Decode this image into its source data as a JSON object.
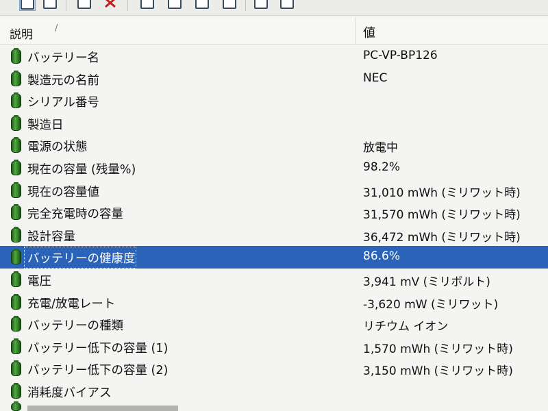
{
  "header": {
    "description": "説明",
    "sort_indicator": "/",
    "value": "値"
  },
  "rows": [
    {
      "label": "バッテリー名",
      "value": "PC-VP-BP126"
    },
    {
      "label": "製造元の名前",
      "value": "NEC"
    },
    {
      "label": "シリアル番号",
      "value": ""
    },
    {
      "label": "製造日",
      "value": ""
    },
    {
      "label": "電源の状態",
      "value": "放電中"
    },
    {
      "label": "現在の容量 (残量%)",
      "value": "98.2%"
    },
    {
      "label": "現在の容量値",
      "value": "31,010 mWh (ミリワット時)"
    },
    {
      "label": "完全充電時の容量",
      "value": "31,570 mWh (ミリワット時)"
    },
    {
      "label": "設計容量",
      "value": "36,472 mWh (ミリワット時)"
    },
    {
      "label": "バッテリーの健康度",
      "value": "86.6%",
      "selected": true
    },
    {
      "label": "電圧",
      "value": "3,941 mV (ミリボルト)"
    },
    {
      "label": "充電/放電レート",
      "value": "-3,620 mW (ミリワット)"
    },
    {
      "label": "バッテリーの種類",
      "value": "リチウム イオン"
    },
    {
      "label": "バッテリー低下の容量 (1)",
      "value": "1,570 mWh (ミリワット時)"
    },
    {
      "label": "バッテリー低下の容量 (2)",
      "value": "3,150 mWh (ミリワット時)"
    },
    {
      "label": "消耗度バイアス",
      "value": ""
    }
  ],
  "colors": {
    "selection": "#2a63b8",
    "battery_icon": "#3f8f33"
  }
}
